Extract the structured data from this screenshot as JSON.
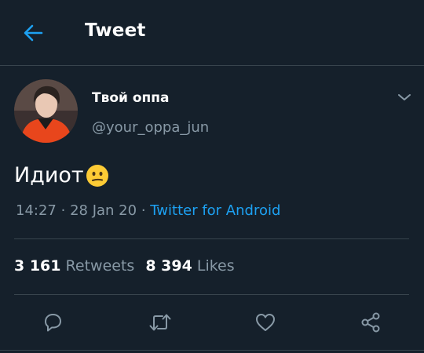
{
  "header": {
    "title": "Tweet",
    "back_icon": "arrow-left-icon"
  },
  "tweet": {
    "display_name": "Твой оппа",
    "username": "@your_oppa_jun",
    "text": "Идиот",
    "emoji": "😕",
    "time": "14:27",
    "date": "28 Jan 20",
    "source": "Twitter for Android",
    "separator": "·"
  },
  "stats": {
    "retweets_count": "3 161",
    "retweets_label": "Retweets",
    "likes_count": "8 394",
    "likes_label": "Likes"
  },
  "actions": [
    "reply-icon",
    "retweet-icon",
    "like-icon",
    "share-icon"
  ],
  "colors": {
    "background": "#15202b",
    "accent": "#1da1f2",
    "muted": "#8899a6",
    "divider": "#38444d"
  }
}
